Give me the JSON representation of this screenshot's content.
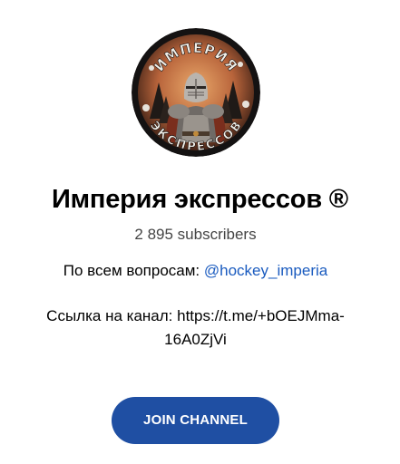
{
  "channel": {
    "title": "Империя экспрессов ®",
    "subscribers": "2 895 subscribers",
    "description": {
      "line1_prefix": "По всем вопросам: ",
      "line1_link": "@hockey_imperia",
      "line2": "Ссылка на канал: https://t.me/+bOEJMma-",
      "line3": "16A0ZjVi"
    },
    "avatar": {
      "logo_top_text": "ИМПЕРИЯ",
      "logo_bottom_text": "ЭКСПРЕССОВ",
      "icon": "knight-logo-icon"
    }
  },
  "actions": {
    "join_label": "JOIN CHANNEL"
  },
  "colors": {
    "accent": "#1f4fa3",
    "link": "#1a5bbf",
    "text": "#000000",
    "muted": "#444444",
    "background": "#ffffff"
  }
}
